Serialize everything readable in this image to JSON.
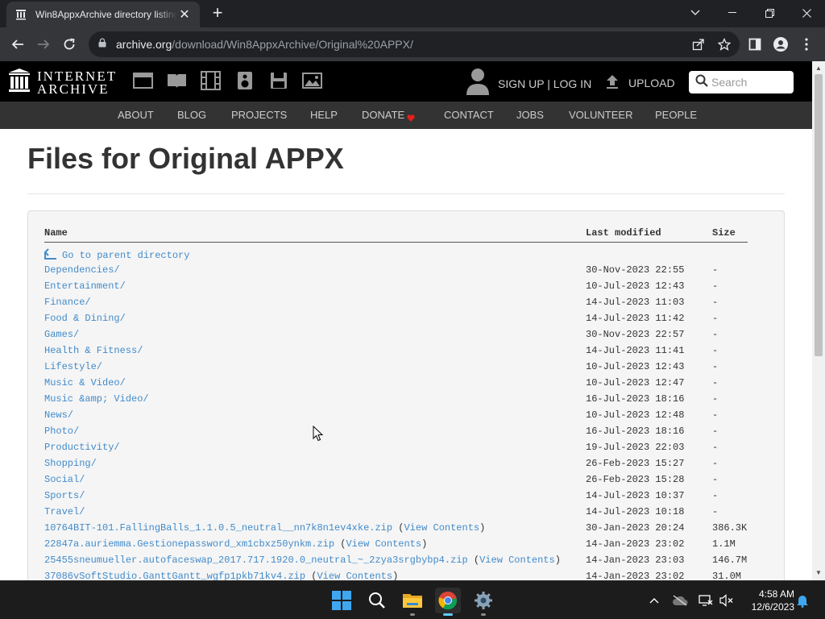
{
  "browser": {
    "tab_title": "Win8AppxArchive directory listing",
    "url_host": "archive.org",
    "url_path": "/download/Win8AppxArchive/Original%20APPX/"
  },
  "ia_header": {
    "logo_line1": "INTERNET",
    "logo_line2": "ARCHIVE",
    "signup_login": "SIGN UP | LOG IN",
    "upload": "UPLOAD",
    "search_placeholder": "Search",
    "nav": [
      "ABOUT",
      "BLOG",
      "PROJECTS",
      "HELP",
      "DONATE",
      "CONTACT",
      "JOBS",
      "VOLUNTEER",
      "PEOPLE"
    ],
    "donate_heart_color": "#e4201b"
  },
  "page": {
    "title": "Files for Original APPX"
  },
  "listing": {
    "headers": {
      "name": "Name",
      "modified": "Last modified",
      "size": "Size"
    },
    "parent_link": "Go to parent directory",
    "view_contents": "View Contents",
    "entries": [
      {
        "name": "Dependencies/",
        "date": "30-Nov-2023 22:55",
        "size": "-"
      },
      {
        "name": "Entertainment/",
        "date": "10-Jul-2023 12:43",
        "size": "-"
      },
      {
        "name": "Finance/",
        "date": "14-Jul-2023 11:03",
        "size": "-"
      },
      {
        "name": "Food & Dining/",
        "date": "14-Jul-2023 11:42",
        "size": "-"
      },
      {
        "name": "Games/",
        "date": "30-Nov-2023 22:57",
        "size": "-"
      },
      {
        "name": "Health & Fitness/",
        "date": "14-Jul-2023 11:41",
        "size": "-"
      },
      {
        "name": "Lifestyle/",
        "date": "10-Jul-2023 12:43",
        "size": "-"
      },
      {
        "name": "Music & Video/",
        "date": "10-Jul-2023 12:47",
        "size": "-"
      },
      {
        "name": "Music &amp; Video/",
        "date": "16-Jul-2023 18:16",
        "size": "-"
      },
      {
        "name": "News/",
        "date": "10-Jul-2023 12:48",
        "size": "-"
      },
      {
        "name": "Photo/",
        "date": "16-Jul-2023 18:16",
        "size": "-"
      },
      {
        "name": "Productivity/",
        "date": "19-Jul-2023 22:03",
        "size": "-"
      },
      {
        "name": "Shopping/",
        "date": "26-Feb-2023 15:27",
        "size": "-"
      },
      {
        "name": "Social/",
        "date": "26-Feb-2023 15:28",
        "size": "-"
      },
      {
        "name": "Sports/",
        "date": "14-Jul-2023 10:37",
        "size": "-"
      },
      {
        "name": "Travel/",
        "date": "14-Jul-2023 10:18",
        "size": "-"
      },
      {
        "name": "10764BIT-101.FallingBalls_1.1.0.5_neutral__nn7k8n1ev4xke.zip",
        "date": "30-Jan-2023 20:24",
        "size": "386.3K",
        "view": true
      },
      {
        "name": "22847a.auriemma.Gestionepassword_xm1cbxz50ynkm.zip",
        "date": "14-Jan-2023 23:02",
        "size": "1.1M",
        "view": true
      },
      {
        "name": "25455sneumueller.autofaceswap_2017.717.1920.0_neutral_~_2zya3srgbybp4.zip",
        "date": "14-Jan-2023 23:03",
        "size": "146.7M",
        "view": true
      },
      {
        "name": "37086vSoftStudio.GanttGantt_wgfp1pkb71kv4.zip",
        "date": "14-Jan-2023 23:02",
        "size": "31.0M",
        "view": true
      }
    ]
  },
  "taskbar": {
    "time": "4:58 AM",
    "date": "12/6/2023",
    "apps": [
      "start-icon",
      "search-icon",
      "file-explorer-icon",
      "chrome-icon",
      "settings-icon"
    ]
  }
}
